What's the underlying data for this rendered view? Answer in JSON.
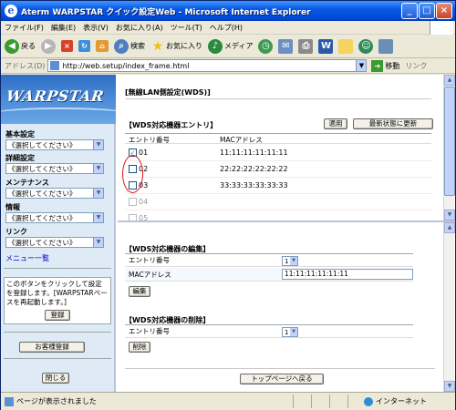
{
  "window": {
    "title": "Aterm WARPSTAR クイック設定Web - Microsoft Internet Explorer",
    "min": "_",
    "max": "□",
    "close": "×"
  },
  "menu": [
    "ファイル(F)",
    "編集(E)",
    "表示(V)",
    "お気に入り(A)",
    "ツール(T)",
    "ヘルプ(H)"
  ],
  "toolbar": {
    "back": "戻る",
    "search": "検索",
    "favorites": "お気に入り",
    "media": "メディア"
  },
  "address": {
    "label": "アドレス(D)",
    "url": "http://web.setup/index_frame.html",
    "go": "移動",
    "links": "リンク"
  },
  "sidebar": {
    "logo": "WARPSTAR",
    "groups": [
      {
        "heading": "基本設定",
        "select": "《選択してください》"
      },
      {
        "heading": "詳細設定",
        "select": "《選択してください》"
      },
      {
        "heading": "メンテナンス",
        "select": "《選択してください》"
      },
      {
        "heading": "情報",
        "select": "《選択してください》"
      },
      {
        "heading": "リンク",
        "select": "《選択してください》"
      }
    ],
    "menu_list": "メニュー一覧",
    "note": "このボタンをクリックして設定を登録します。[WARPSTARベースを再起動します。]",
    "register": "登録",
    "customer": "お客様登録",
    "close": "閉じる"
  },
  "top": {
    "page_title": "[無線LAN側設定(WDS)]",
    "section_title": "【WDS対応機器エントリ】",
    "apply": "適用",
    "refresh": "最新状態に更新",
    "col_entry": "エントリ番号",
    "col_mac": "MACアドレス",
    "rows": [
      {
        "no": "01",
        "mac": "11:11:11:11:11:11",
        "checked": true
      },
      {
        "no": "02",
        "mac": "22:22:22:22:22:22",
        "checked": false
      },
      {
        "no": "03",
        "mac": "33:33:33:33:33:33",
        "checked": false
      },
      {
        "no": "04",
        "mac": "",
        "checked": false
      },
      {
        "no": "05",
        "mac": "",
        "checked": false
      }
    ]
  },
  "edit": {
    "title": "【WDS対応機器の編集】",
    "entry_label": "エントリ番号",
    "entry_value": "1",
    "mac_label": "MACアドレス",
    "mac_value": "11:11:11:11:11:11",
    "button": "編集"
  },
  "delete": {
    "title": "【WDS対応機器の削除】",
    "entry_label": "エントリ番号",
    "entry_value": "1",
    "button": "削除"
  },
  "top_page": "トップページへ戻る",
  "status": {
    "text": "ページが表示されました",
    "zone": "インターネット"
  }
}
